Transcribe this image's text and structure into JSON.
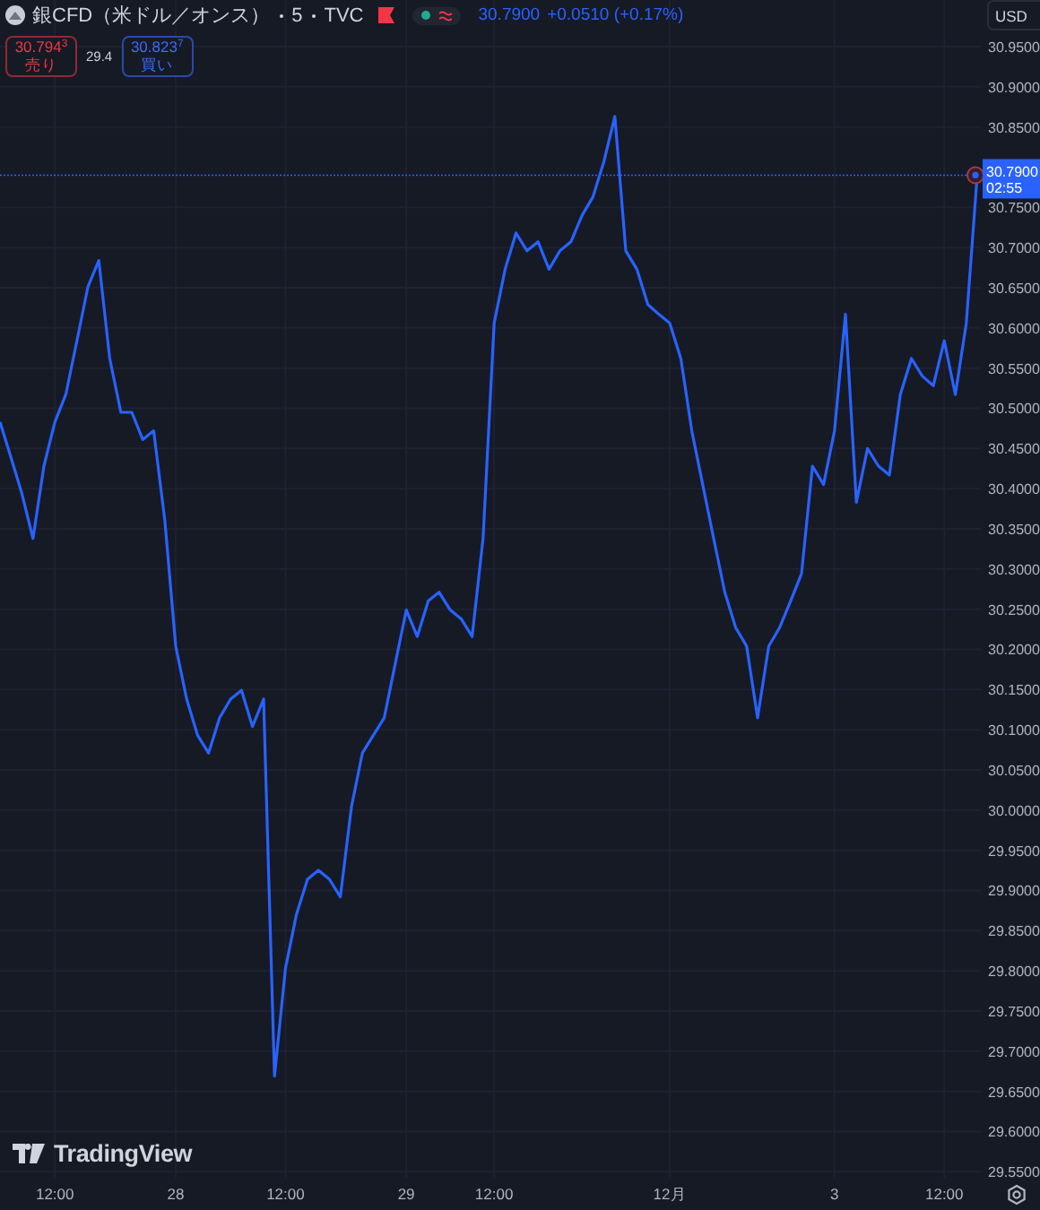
{
  "header": {
    "symbol": "銀CFD（米ドル／オンス）",
    "interval": "5",
    "exchange": "TVC",
    "last_price": "30.7900",
    "change": "+0.0510 (+0.17%)"
  },
  "trade": {
    "sell": {
      "price": "30.794$^{3}$",
      "label": "売り"
    },
    "spread": "29.4",
    "buy": {
      "price": "30.823$^{7}$",
      "label": "買い"
    }
  },
  "price_axis": {
    "currency": "USD"
  },
  "price_badge": {
    "price": "30.7900",
    "countdown": "02:55"
  },
  "chart_data": {
    "type": "line",
    "grid": true,
    "ylim": [
      29.547,
      31.008
    ],
    "ref_lines": [
      {
        "axis": "y",
        "value": 30.79,
        "color": "#2962ff"
      }
    ],
    "categories": [
      null,
      null,
      null,
      null,
      null,
      "12:00",
      null,
      null,
      null,
      null,
      null,
      null,
      null,
      null,
      null,
      null,
      "28",
      null,
      null,
      null,
      null,
      null,
      null,
      null,
      null,
      null,
      "12:00",
      null,
      null,
      null,
      null,
      null,
      null,
      null,
      null,
      null,
      null,
      "29",
      null,
      null,
      null,
      null,
      null,
      null,
      null,
      "12:00",
      null,
      null,
      null,
      null,
      null,
      null,
      null,
      null,
      null,
      null,
      null,
      null,
      null,
      null,
      null,
      "12月",
      null,
      null,
      null,
      null,
      null,
      null,
      null,
      null,
      null,
      null,
      null,
      null,
      null,
      null,
      "3",
      null,
      null,
      null,
      null,
      null,
      null,
      null,
      null,
      null,
      "12:00",
      null,
      null,
      null
    ],
    "values": [
      30.483,
      30.439,
      30.394,
      30.338,
      30.428,
      30.483,
      30.517,
      30.584,
      30.651,
      30.684,
      30.562,
      30.495,
      30.495,
      30.461,
      30.472,
      30.361,
      30.204,
      30.138,
      30.093,
      30.071,
      30.115,
      30.138,
      30.149,
      30.104,
      30.138,
      29.669,
      29.803,
      29.87,
      29.914,
      29.925,
      29.914,
      29.892,
      30.004,
      30.071,
      30.093,
      30.115,
      30.182,
      30.249,
      30.216,
      30.26,
      30.271,
      30.249,
      30.238,
      30.216,
      30.338,
      30.606,
      30.673,
      30.718,
      30.696,
      30.707,
      30.673,
      30.696,
      30.707,
      30.74,
      30.763,
      30.807,
      30.863,
      30.696,
      30.673,
      30.629,
      30.617,
      30.606,
      30.562,
      30.472,
      30.405,
      30.338,
      30.271,
      30.227,
      30.204,
      30.115,
      30.204,
      30.227,
      30.26,
      30.294,
      30.428,
      30.405,
      30.472,
      30.617,
      30.383,
      30.45,
      30.428,
      30.417,
      30.517,
      30.562,
      30.54,
      30.528,
      30.584,
      30.517,
      30.606,
      30.79
    ],
    "yticks": [
      {
        "value": 30.95,
        "label": "30.9500"
      },
      {
        "value": 30.9,
        "label": "30.9000"
      },
      {
        "value": 30.85,
        "label": "30.8500"
      },
      {
        "value": 30.75,
        "label": "30.7500"
      },
      {
        "value": 30.7,
        "label": "30.7000"
      },
      {
        "value": 30.65,
        "label": "30.6500"
      },
      {
        "value": 30.6,
        "label": "30.6000"
      },
      {
        "value": 30.55,
        "label": "30.5500"
      },
      {
        "value": 30.5,
        "label": "30.5000"
      },
      {
        "value": 30.45,
        "label": "30.4500"
      },
      {
        "value": 30.4,
        "label": "30.4000"
      },
      {
        "value": 30.35,
        "label": "30.3500"
      },
      {
        "value": 30.3,
        "label": "30.3000"
      },
      {
        "value": 30.25,
        "label": "30.2500"
      },
      {
        "value": 30.2,
        "label": "30.2000"
      },
      {
        "value": 30.15,
        "label": "30.1500"
      },
      {
        "value": 30.1,
        "label": "30.1000"
      },
      {
        "value": 30.05,
        "label": "30.0500"
      },
      {
        "value": 30.0,
        "label": "30.0000"
      },
      {
        "value": 29.95,
        "label": "29.9500"
      },
      {
        "value": 29.9,
        "label": "29.9000"
      },
      {
        "value": 29.85,
        "label": "29.8500"
      },
      {
        "value": 29.8,
        "label": "29.8000"
      },
      {
        "value": 29.75,
        "label": "29.7500"
      },
      {
        "value": 29.7,
        "label": "29.7000"
      },
      {
        "value": 29.65,
        "label": "29.6500"
      },
      {
        "value": 29.6,
        "label": "29.6000"
      },
      {
        "value": 29.55,
        "label": "29.5500"
      }
    ]
  },
  "logo": {
    "text": "TradingView"
  }
}
